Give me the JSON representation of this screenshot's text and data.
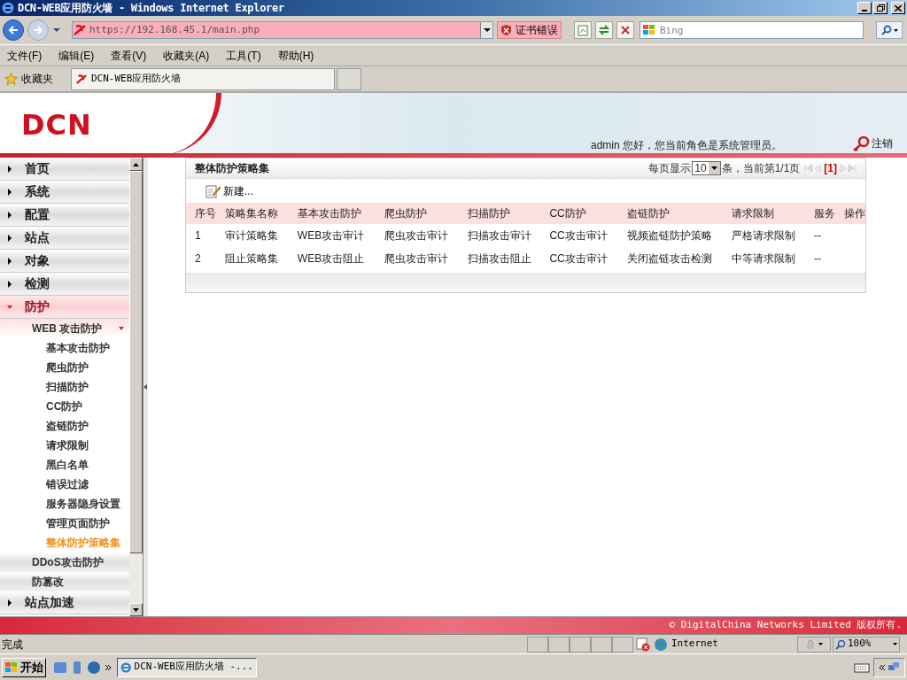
{
  "browser": {
    "title": "DCN-WEB应用防火墙 - Windows Internet Explorer",
    "address": "https://192.168.45.1/main.php",
    "cert_error": "证书错误",
    "search_placeholder": "Bing",
    "menu": [
      "文件(F)",
      "编辑(E)",
      "查看(V)",
      "收藏夹(A)",
      "工具(T)",
      "帮助(H)"
    ],
    "favorites_label": "收藏夹",
    "tab_title": "DCN-WEB应用防火墙"
  },
  "header": {
    "logo": "DCN",
    "greeting": "admin 您好，您当前角色是系统管理员。",
    "logout": "注销"
  },
  "sidebar": {
    "items": [
      {
        "label": "首页",
        "expanded": false
      },
      {
        "label": "系统",
        "expanded": false
      },
      {
        "label": "配置",
        "expanded": false
      },
      {
        "label": "站点",
        "expanded": false
      },
      {
        "label": "对象",
        "expanded": false
      },
      {
        "label": "检测",
        "expanded": false
      },
      {
        "label": "防护",
        "expanded": true,
        "children": [
          {
            "label": "WEB 攻击防护",
            "expanded": true,
            "children": [
              {
                "label": "基本攻击防护",
                "selected": false
              },
              {
                "label": "爬虫防护",
                "selected": false
              },
              {
                "label": "扫描防护",
                "selected": false
              },
              {
                "label": "CC防护",
                "selected": false
              },
              {
                "label": "盗链防护",
                "selected": false
              },
              {
                "label": "请求限制",
                "selected": false
              },
              {
                "label": "黑白名单",
                "selected": false
              },
              {
                "label": "错误过滤",
                "selected": false
              },
              {
                "label": "服务器隐身设置",
                "selected": false
              },
              {
                "label": "管理页面防护",
                "selected": false
              },
              {
                "label": "整体防护策略集",
                "selected": true
              }
            ]
          },
          {
            "label": "DDoS攻击防护",
            "expanded": false
          },
          {
            "label": "防篡改",
            "expanded": false
          }
        ]
      },
      {
        "label": "站点加速",
        "expanded": false
      }
    ]
  },
  "panel": {
    "title": "整体防护策略集",
    "page_size_label": "每页显示",
    "page_size": "10",
    "page_info": "条，当前第1/1页",
    "current_page": "[1]",
    "new_label": "新建...",
    "columns": [
      "序号",
      "策略集名称",
      "基本攻击防护",
      "爬虫防护",
      "扫描防护",
      "CC防护",
      "盗链防护",
      "请求限制",
      "服务",
      "操作"
    ],
    "rows": [
      [
        "1",
        "审计策略集",
        "WEB攻击审计",
        "爬虫攻击审计",
        "扫描攻击审计",
        "CC攻击审计",
        "视频盗链防护策略",
        "严格请求限制",
        "--"
      ],
      [
        "2",
        "阻止策略集",
        "WEB攻击阻止",
        "爬虫攻击审计",
        "扫描攻击阻止",
        "CC攻击审计",
        "关闭盗链攻击检测",
        "中等请求限制",
        "--"
      ]
    ]
  },
  "footer": {
    "copyright": "© DigitalChina Networks Limited 版权所有."
  },
  "status_bar": {
    "text": "完成",
    "zone": "Internet",
    "zoom": "100%"
  },
  "taskbar": {
    "start": "开始",
    "task": "DCN-WEB应用防火墙 -..."
  }
}
